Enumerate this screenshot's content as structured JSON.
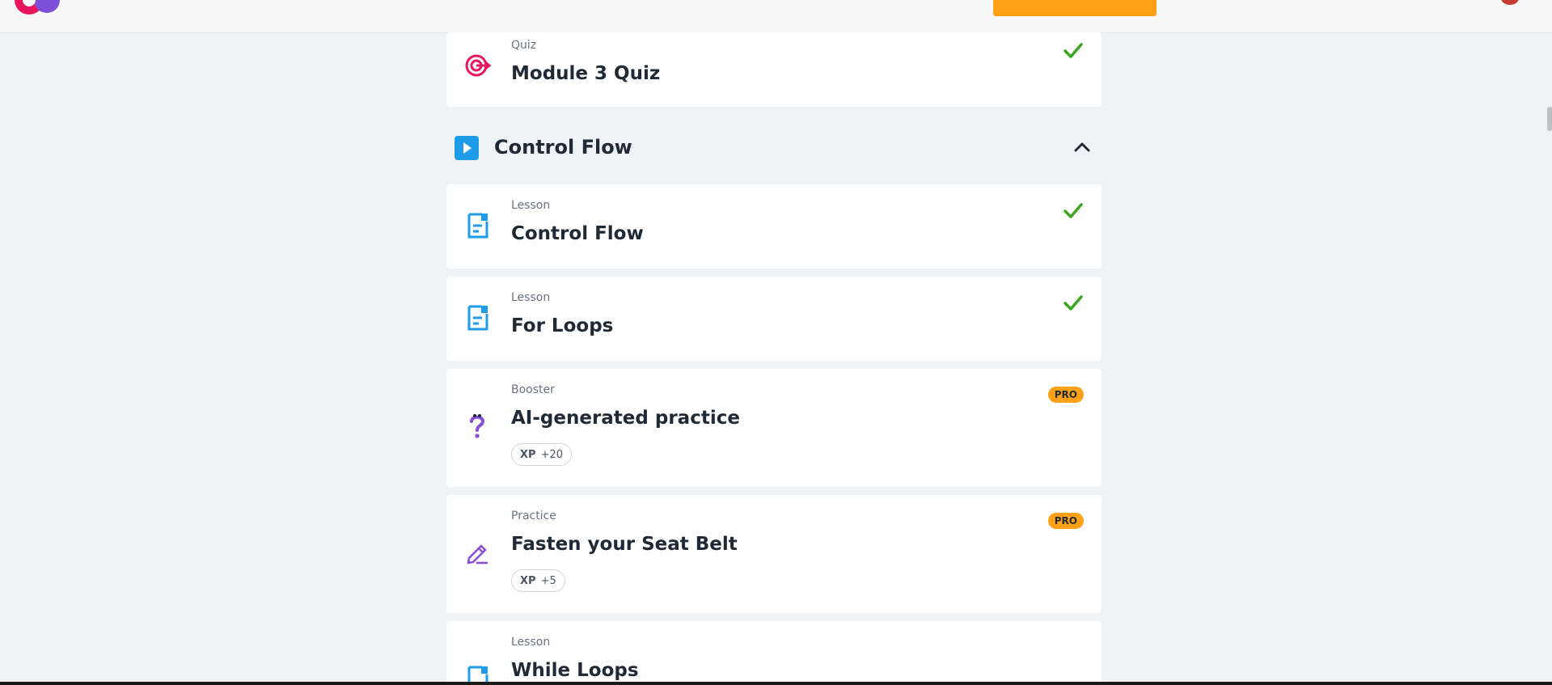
{
  "header": {
    "logo_text": "",
    "colors": {
      "brand_pink": "#e8175d",
      "brand_purple": "#7b4fd6",
      "cta": "#ffa116"
    }
  },
  "cards_top": {
    "quiz": {
      "type": "Quiz",
      "title": "Module 3 Quiz",
      "icon": "target-icon",
      "completed": true
    }
  },
  "section": {
    "title": "Control Flow",
    "icon": "play-icon",
    "expanded": true
  },
  "items": [
    {
      "type": "Lesson",
      "title": "Control Flow",
      "icon": "document-icon",
      "completed": true
    },
    {
      "type": "Lesson",
      "title": "For Loops",
      "icon": "document-icon",
      "completed": true
    },
    {
      "type": "Booster",
      "title": "AI-generated practice",
      "icon": "question-icon",
      "badge": "PRO",
      "xp_label": "XP",
      "xp_value": "+20"
    },
    {
      "type": "Practice",
      "title": "Fasten your Seat Belt",
      "icon": "pencil-icon",
      "badge": "PRO",
      "xp_label": "XP",
      "xp_value": "+5"
    },
    {
      "type": "Lesson",
      "title": "While Loops",
      "icon": "document-icon"
    }
  ],
  "colors": {
    "check_green": "#3aa520",
    "icon_blue": "#1e9be9",
    "icon_purple": "#8a4fd6",
    "pro_orange": "#ffa116",
    "quiz_pink": "#e8175d"
  }
}
